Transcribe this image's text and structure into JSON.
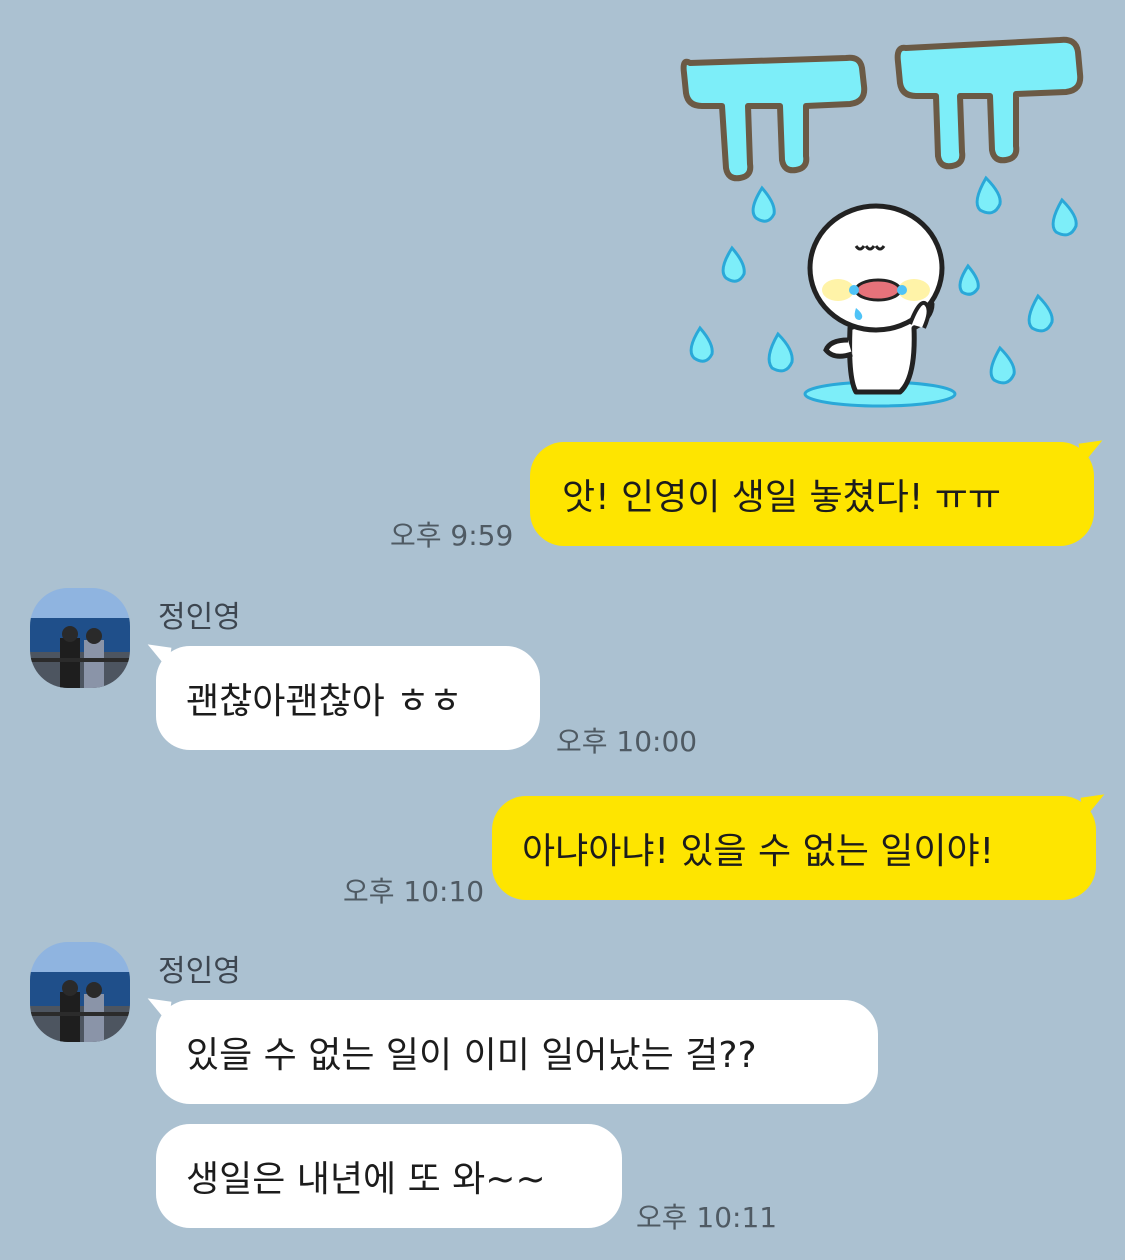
{
  "messages": [
    {
      "side": "me",
      "kind": "sticker",
      "sticker_text": "ㅠㅠ",
      "sticker_icon": "crying-character-sticker"
    },
    {
      "side": "me",
      "kind": "text",
      "text": "앗! 인영이 생일 놓쳤다! ㅠㅠ",
      "time": "오후 9:59"
    },
    {
      "side": "them",
      "sender": "정인영",
      "kind": "text",
      "text": "괜찮아괜찮아 ㅎㅎ",
      "time": "오후 10:00"
    },
    {
      "side": "me",
      "kind": "text",
      "text": "아냐아냐! 있을 수 없는 일이야!",
      "time": "오후 10:10"
    },
    {
      "side": "them",
      "sender": "정인영",
      "kind": "text",
      "text": "있을 수 없는 일이 이미 일어났는 걸??"
    },
    {
      "side": "them",
      "kind": "text",
      "text": "생일은 내년에 또 와~~",
      "time": "오후 10:11"
    }
  ],
  "colors": {
    "background": "#abc1d1",
    "my_bubble": "#fee500",
    "their_bubble": "#ffffff"
  }
}
